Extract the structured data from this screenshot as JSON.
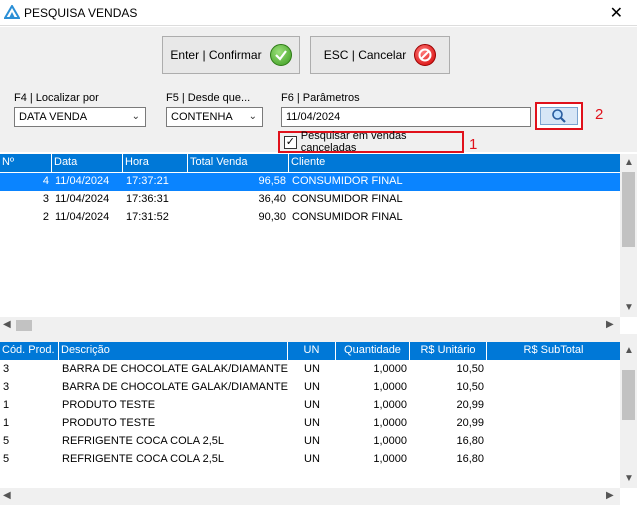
{
  "window": {
    "title": "PESQUISA VENDAS"
  },
  "toolbar": {
    "confirm_label": "Enter | Confirmar",
    "cancel_label": "ESC | Cancelar"
  },
  "search": {
    "locate_label": "F4 | Localizar por",
    "locate_value": "DATA VENDA",
    "since_label": "F5 | Desde que...",
    "since_value": "CONTENHA",
    "params_label": "F6 | Parâmetros",
    "params_value": "11/04/2024",
    "cancelled_label": "Pesquisar em vendas canceladas",
    "cancelled_checked": true,
    "callout_1": "1",
    "callout_2": "2"
  },
  "sales": {
    "columns": [
      "Nº",
      "Data",
      "Hora",
      "Total Venda",
      "Cliente"
    ],
    "rows": [
      {
        "num": "4",
        "date": "11/04/2024",
        "time": "17:37:21",
        "total": "96,58",
        "client": "CONSUMIDOR FINAL",
        "selected": true
      },
      {
        "num": "3",
        "date": "11/04/2024",
        "time": "17:36:31",
        "total": "36,40",
        "client": "CONSUMIDOR FINAL",
        "selected": false
      },
      {
        "num": "2",
        "date": "11/04/2024",
        "time": "17:31:52",
        "total": "90,30",
        "client": "CONSUMIDOR FINAL",
        "selected": false
      }
    ]
  },
  "items": {
    "columns": [
      "Cód. Prod.",
      "Descrição",
      "UN",
      "Quantidade",
      "R$ Unitário",
      "R$ SubTotal"
    ],
    "rows": [
      {
        "code": "3",
        "desc": "BARRA DE CHOCOLATE GALAK/DIAMANTE NEGRO",
        "un": "UN",
        "qty": "1,0000",
        "unit": "10,50",
        "subtotal": ""
      },
      {
        "code": "3",
        "desc": "BARRA DE CHOCOLATE GALAK/DIAMANTE NEGRO",
        "un": "UN",
        "qty": "1,0000",
        "unit": "10,50",
        "subtotal": ""
      },
      {
        "code": "1",
        "desc": "PRODUTO TESTE",
        "un": "UN",
        "qty": "1,0000",
        "unit": "20,99",
        "subtotal": ""
      },
      {
        "code": "1",
        "desc": "PRODUTO TESTE",
        "un": "UN",
        "qty": "1,0000",
        "unit": "20,99",
        "subtotal": ""
      },
      {
        "code": "5",
        "desc": "REFRIGENTE COCA COLA 2,5L",
        "un": "UN",
        "qty": "1,0000",
        "unit": "16,80",
        "subtotal": ""
      },
      {
        "code": "5",
        "desc": "REFRIGENTE COCA COLA 2,5L",
        "un": "UN",
        "qty": "1,0000",
        "unit": "16,80",
        "subtotal": ""
      }
    ]
  },
  "colors": {
    "header_blue": "#0078d7",
    "selection_blue": "#0a84ff",
    "callout_red": "#e0111b"
  }
}
